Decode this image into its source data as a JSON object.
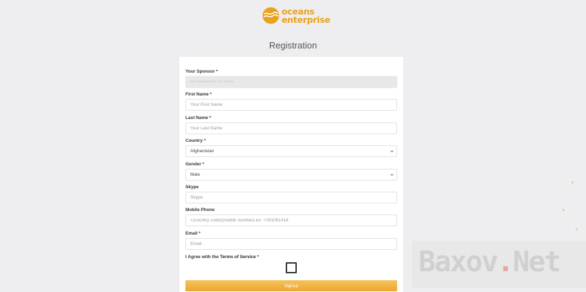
{
  "brand": {
    "line1": "oceans",
    "line2": "enterprise"
  },
  "page_title": "Registration",
  "form": {
    "sponsor": {
      "label": "Your Sponsor *",
      "value": "•••• •••••••••••• ••• ••••••"
    },
    "first_name": {
      "label": "First Name *",
      "placeholder": "Your First Name"
    },
    "last_name": {
      "label": "Last Name *",
      "placeholder": "Your Last Name"
    },
    "country": {
      "label": "Country *",
      "value": "Afghanistan"
    },
    "gender": {
      "label": "Gender *",
      "value": "Male"
    },
    "skype": {
      "label": "Skype",
      "placeholder": "Skype"
    },
    "mobile": {
      "label": "Mobile Phone",
      "placeholder": "+(country code)(mobile number)-ex: +191061418"
    },
    "email": {
      "label": "Email *",
      "placeholder": "Email"
    },
    "terms": {
      "prefix": "I Agree with the ",
      "link": "Terms of Service",
      "suffix": " *"
    },
    "submit_label": "Signup"
  },
  "watermark": {
    "part1": "Baxov",
    "dot": ".",
    "part2": "Net"
  },
  "colors": {
    "accent": "#eda631",
    "brand": "#e9a21f",
    "background": "#eeeef0"
  }
}
